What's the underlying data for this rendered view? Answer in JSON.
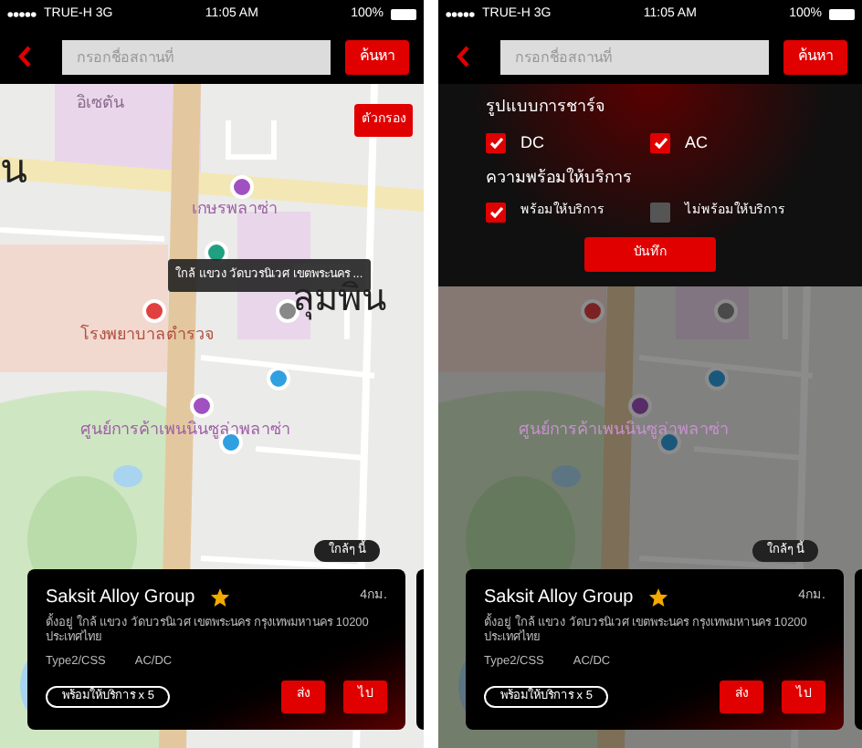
{
  "screens": [
    {
      "status_bar": {
        "carrier": "TRUE-H 3G",
        "time": "11:05 AM",
        "battery": "100%"
      },
      "search": {
        "placeholder": "กรอกชื่อสถานที่",
        "button": "ค้นหา"
      },
      "filter_button": "ตัวกรอง",
      "map": {
        "dimmed": false,
        "labels": [
          "อิเซตัน",
          "น",
          "เกษรพลาซ่า",
          "ลุมพิน",
          "โรงพยาบาลตำรวจ",
          "ศูนย์การค้าเพนนินซูล่าพลาซ่า"
        ],
        "tooltip": "ใกล้ แขวง วัดบวรนิเวศ เขตพระนคร ..."
      },
      "nearby_button": "ใกล้ๆ นี้",
      "card": {
        "name": "Saksit Alloy Group",
        "favorite": true,
        "distance": "4กม.",
        "address": "ตั้งอยู่ ใกล้ แขวง วัดบวรนิเวศ เขตพระนคร กรุงเทพมหานคร 10200 ประเทศไทย",
        "plug": "Type2/CSS",
        "current": "AC/DC",
        "availability": "พร้อมให้บริการ x 5",
        "buttons": [
          "ส่ง",
          "ไป"
        ]
      }
    },
    {
      "status_bar": {
        "carrier": "TRUE-H 3G",
        "time": "11:05 AM",
        "battery": "100%"
      },
      "search": {
        "placeholder": "กรอกชื่อสถานที่",
        "button": "ค้นหา"
      },
      "filter_panel": {
        "sections": [
          {
            "title": "รูปแบบการชาร์จ",
            "options": [
              {
                "label": "DC",
                "checked": true
              },
              {
                "label": "AC",
                "checked": true
              }
            ]
          },
          {
            "title": "ความพร้อมให้บริการ",
            "options": [
              {
                "label": "พร้อมให้บริการ",
                "checked": true
              },
              {
                "label": "ไม่พร้อมให้บริการ",
                "checked": false
              }
            ]
          }
        ],
        "save_button": "บันทึก"
      },
      "map": {
        "dimmed": true,
        "labels": [
          "ศูนย์การค้าเพนนินซูล่าพลาซ่า"
        ]
      },
      "nearby_button": "ใกล้ๆ นี้",
      "card": {
        "name": "Saksit Alloy Group",
        "favorite": true,
        "distance": "4กม.",
        "address": "ตั้งอยู่ ใกล้ แขวง วัดบวรนิเวศ เขตพระนคร กรุงเทพมหานคร 10200 ประเทศไทย",
        "plug": "Type2/CSS",
        "current": "AC/DC",
        "availability": "พร้อมให้บริการ x 5",
        "buttons": [
          "ส่ง",
          "ไป"
        ]
      }
    }
  ]
}
